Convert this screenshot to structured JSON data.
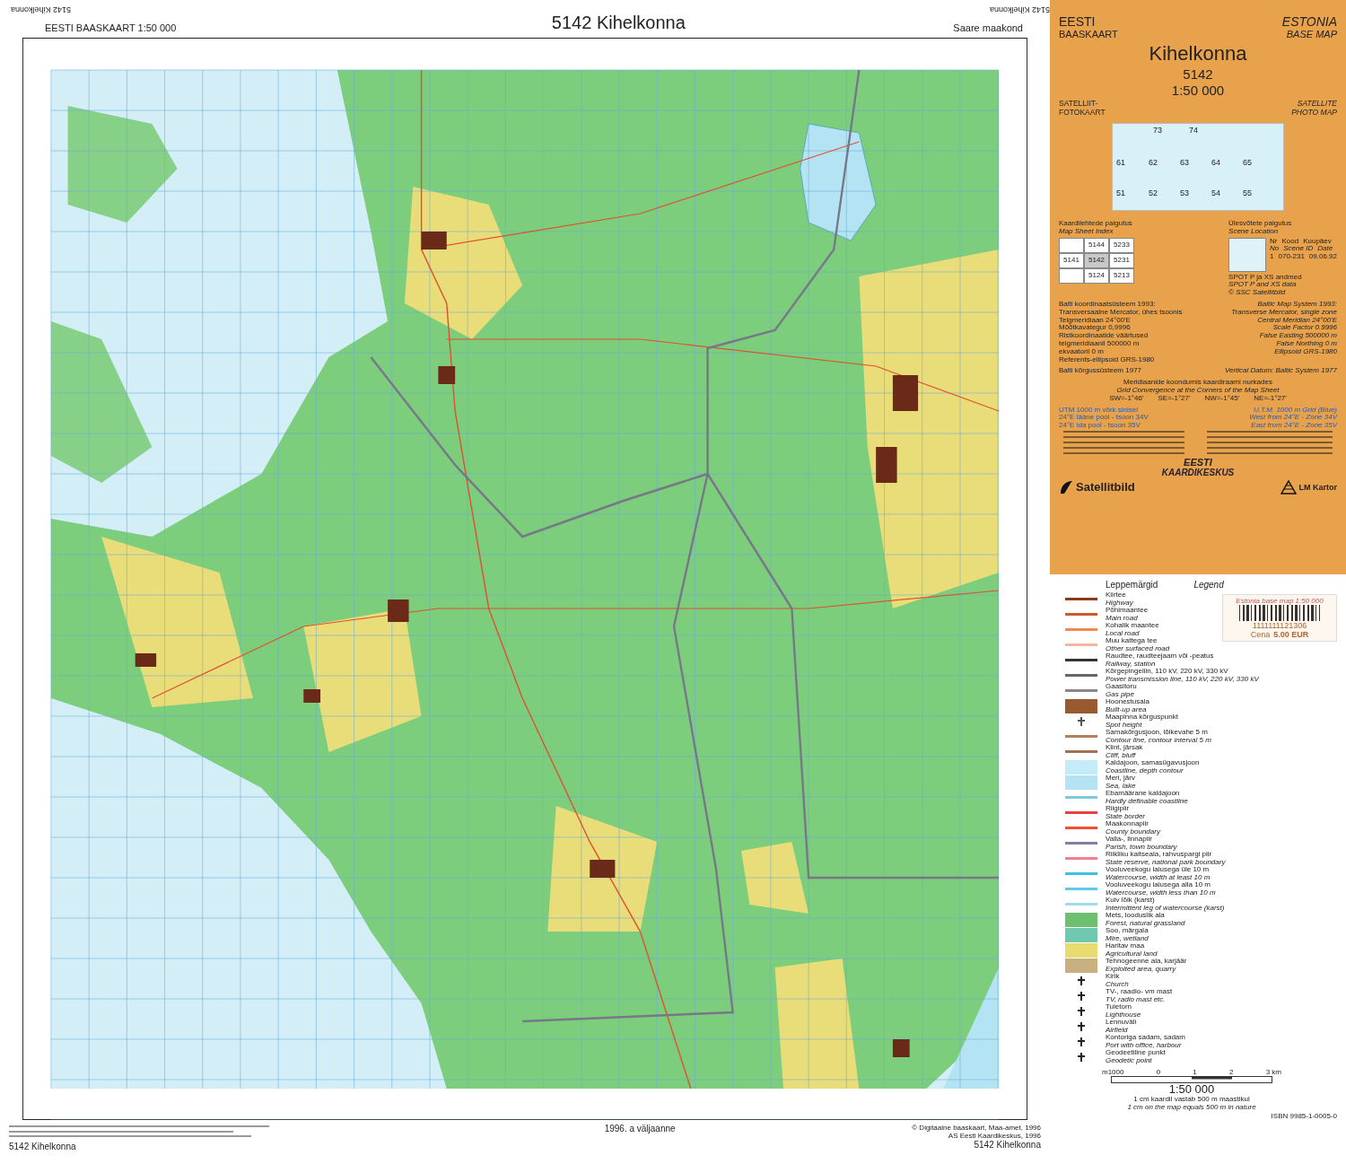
{
  "header": {
    "mirrored_label_left": "5142 Kihelkonna",
    "series": "EESTI  BAASKAART  1:50 000",
    "title": "5142  Kihelkonna",
    "county": "Saare  maakond",
    "mirrored_label_right": "5142 Kihelkonna"
  },
  "footer": {
    "sheet_label_left": "5142  Kihelkonna",
    "edition": "1996. a väljaanne",
    "copyright": [
      "© Digitaalne baaskaart, Maa-amet, 1996",
      "AS Eesti Kaardikeskus, 1996"
    ],
    "sheet_label_right": "5142  Kihelkonna"
  },
  "cover": {
    "series_et": [
      "EESTI",
      "BAASKAART"
    ],
    "series_en": [
      "ESTONIA",
      "BASE MAP"
    ],
    "name": "Kihelkonna",
    "sheet": "5142",
    "scale": "1:50 000",
    "type_et": [
      "SATELLIIT-",
      "FOTOKAART"
    ],
    "type_en": [
      "SATELLITE",
      "PHOTO MAP"
    ],
    "overview_labels": [
      "73",
      "74",
      "61",
      "62",
      "63",
      "64",
      "65",
      "51",
      "52",
      "53",
      "54",
      "55"
    ],
    "index_title": [
      "Kaardilehtede paigutus",
      "Map Sheet Index"
    ],
    "index_cells": [
      {
        "selected": false
      },
      {
        "label": "5144",
        "selected": false
      },
      {
        "label": "5233",
        "selected": false
      },
      {
        "label": "5141",
        "selected": false
      },
      {
        "label": "5142",
        "selected": true
      },
      {
        "label": "5231",
        "selected": false
      },
      {
        "selected": false
      },
      {
        "label": "5124",
        "selected": false
      },
      {
        "label": "5213",
        "selected": false
      }
    ],
    "scene_title": [
      "Ülesvõtete paigutus",
      "Scene Location"
    ],
    "scene_head_et": [
      "Nr",
      "Kood",
      "Kuupäev"
    ],
    "scene_head_en": [
      "No",
      "Scene ID",
      "Date"
    ],
    "scene_row": [
      "1",
      "070-231",
      "09.06.92"
    ],
    "scene_credit": [
      "SPOT P ja XS andmed",
      "SPOT P and XS data",
      "© SSC Satellitbild"
    ],
    "projection_et": [
      "Balti koordinaatsüsteem 1993:",
      "Transversaalne Mercator, ühes tsoonis",
      "Telgmeridiaan 24°00'E",
      "Mõõtkavategur 0,9996",
      "Ristkoordinaatide väärtused",
      "telgmeridiaanil 500000 m",
      "ekvaatoril 0 m",
      "Referents-ellipsoid GRS-1980"
    ],
    "projection_en": [
      "Baltic Map System 1993:",
      "Transverse Mercator, single zone",
      "Central Meridian 24°00'E",
      "Scale Factor 0.9996",
      "False Easting 500000 m",
      "False Northing 0 m",
      "Ellipsoid GRS-1980"
    ],
    "datum_et": "Balti kõrgussüsteem 1977",
    "datum_en": "Vertical Datum: Baltic System 1977",
    "convergence_et": "Meridiaanide koondumis kaardiraami nurkades",
    "convergence_en": "Grid Convergence at the Corners of the Map Sheet",
    "convergence_values": [
      "SW=-1°46'",
      "SE=-1°27'",
      "NW=-1°45'",
      "NE=-1°27'"
    ],
    "utm_et": [
      "UTM 1000 m võrk sinisel",
      "24°E lääne pool - tsoon 34V",
      "24°E ida pool - tsoon 35V"
    ],
    "utm_en": [
      "U.T.M. 1000 m Grid (Blue)",
      "West from 24°E - Zone 34V",
      "East from 24°E - Zone 35V"
    ],
    "logos": [
      "EESTI",
      "KAARDIKESKUS",
      "Satellitbild",
      "LM Kartor"
    ]
  },
  "legend": {
    "title_et": "Leppemärgid",
    "title_en": "Legend",
    "items": [
      {
        "kind": "line",
        "color": "#8b3a1a",
        "et": "Kiirtee",
        "en": "Highway"
      },
      {
        "kind": "line",
        "color": "#d0582a",
        "et": "Põhimaantee",
        "en": "Main road"
      },
      {
        "kind": "line",
        "color": "#f08a50",
        "et": "Kohalik maantee",
        "en": "Local road"
      },
      {
        "kind": "line",
        "color": "#f4b8a0",
        "et": "Muu kattega tee",
        "en": "Other surfaced road"
      },
      {
        "kind": "line",
        "color": "#333333",
        "et": "Raudtee, raudteejaam või -peatus",
        "en": "Railway, station"
      },
      {
        "kind": "line",
        "color": "#666666",
        "et": "Kõrgepingeliin, 110 kV, 220 kV, 330 kV",
        "en": "Power transmission line, 110 kV, 220 kV, 330 kV"
      },
      {
        "kind": "line",
        "color": "#888888",
        "et": "Gaasitoru",
        "en": "Gas pipe"
      },
      {
        "kind": "area",
        "color": "#9a5a30",
        "et": "Hoonestusala",
        "en": "Built-up area"
      },
      {
        "kind": "point",
        "color": "#555555",
        "et": "Maapinna kõrguspunkt",
        "en": "Spot height"
      },
      {
        "kind": "line",
        "color": "#b08060",
        "et": "Samakõrgusjoon, lõikevahe 5 m",
        "en": "Contour line, contour interval 5 m"
      },
      {
        "kind": "line",
        "color": "#a07050",
        "et": "Klint, järsak",
        "en": "Cliff, bluff"
      },
      {
        "kind": "area",
        "color": "#c4ecf8",
        "et": "Kaldajoon, samasügavusjoon",
        "en": "Coastline, depth contour"
      },
      {
        "kind": "area",
        "color": "#b4e4f4",
        "et": "Meri, järv",
        "en": "Sea, lake"
      },
      {
        "kind": "line",
        "color": "#7fc8e0",
        "et": "Ebamäärane kaldajoon",
        "en": "Hardly definable coastline"
      },
      {
        "kind": "line",
        "color": "#e84040",
        "et": "Riigipiir",
        "en": "State border"
      },
      {
        "kind": "line",
        "color": "#f05030",
        "et": "Maakonnapiir",
        "en": "County boundary"
      },
      {
        "kind": "line",
        "color": "#8080a0",
        "et": "Valla-, linnapiir",
        "en": "Parish, town boundary"
      },
      {
        "kind": "line",
        "color": "#f08090",
        "et": "Riikliku kaitseala, rahvuspargi piir",
        "en": "State reserve, national park boundary"
      },
      {
        "kind": "line",
        "color": "#40c0e0",
        "et": "Vooluveekogu laiusega üle 10 m",
        "en": "Watercourse, width at least 10 m"
      },
      {
        "kind": "line",
        "color": "#60c8e8",
        "et": "Vooluveekogu laiusega alla 10 m",
        "en": "Watercourse, width less than 10 m"
      },
      {
        "kind": "line",
        "color": "#a0dcf0",
        "et": "Kuiv lõik (karst)",
        "en": "Intermittent leg of watercourse (karst)"
      },
      {
        "kind": "area",
        "color": "#6cc070",
        "et": "Mets, looduslik ala",
        "en": "Forest, natural grassland"
      },
      {
        "kind": "area",
        "color": "#70c8b0",
        "et": "Soo, märgala",
        "en": "Mire, wetland"
      },
      {
        "kind": "area",
        "color": "#e8dc70",
        "et": "Haritav maa",
        "en": "Agricultural land"
      },
      {
        "kind": "area",
        "color": "#c8b080",
        "et": "Tehnogeenne ala, karjäär",
        "en": "Exploited area, quarry"
      },
      {
        "kind": "point",
        "color": "#222222",
        "et": "Kirik",
        "en": "Church"
      },
      {
        "kind": "point",
        "color": "#222222",
        "et": "TV-, raadio- vm mast",
        "en": "TV, radio mast etc."
      },
      {
        "kind": "point",
        "color": "#222222",
        "et": "Tuletorn",
        "en": "Lighthouse"
      },
      {
        "kind": "point",
        "color": "#222222",
        "et": "Lennuväli",
        "en": "Airfield"
      },
      {
        "kind": "point",
        "color": "#222222",
        "et": "Kontoriga sadam, sadam",
        "en": "Port with office, harbour"
      },
      {
        "kind": "point",
        "color": "#222222",
        "et": "Geodeetiline punkt",
        "en": "Geodetic point"
      }
    ]
  },
  "price_sticker": {
    "title": "Estonia base map 1:50 000",
    "code": "1111111121306",
    "price_label": "Cena",
    "price": "5.00 EUR"
  },
  "scale_bar": {
    "ticks": [
      "m1000",
      "0",
      "1",
      "2",
      "3 km"
    ],
    "scale": "1:50 000",
    "note_et": "1 cm kaardil vastab 500 m maastikul",
    "note_en": "1 cm on the map equals 500 m in nature"
  },
  "isbn": "ISBN 9985-1-0005-0"
}
